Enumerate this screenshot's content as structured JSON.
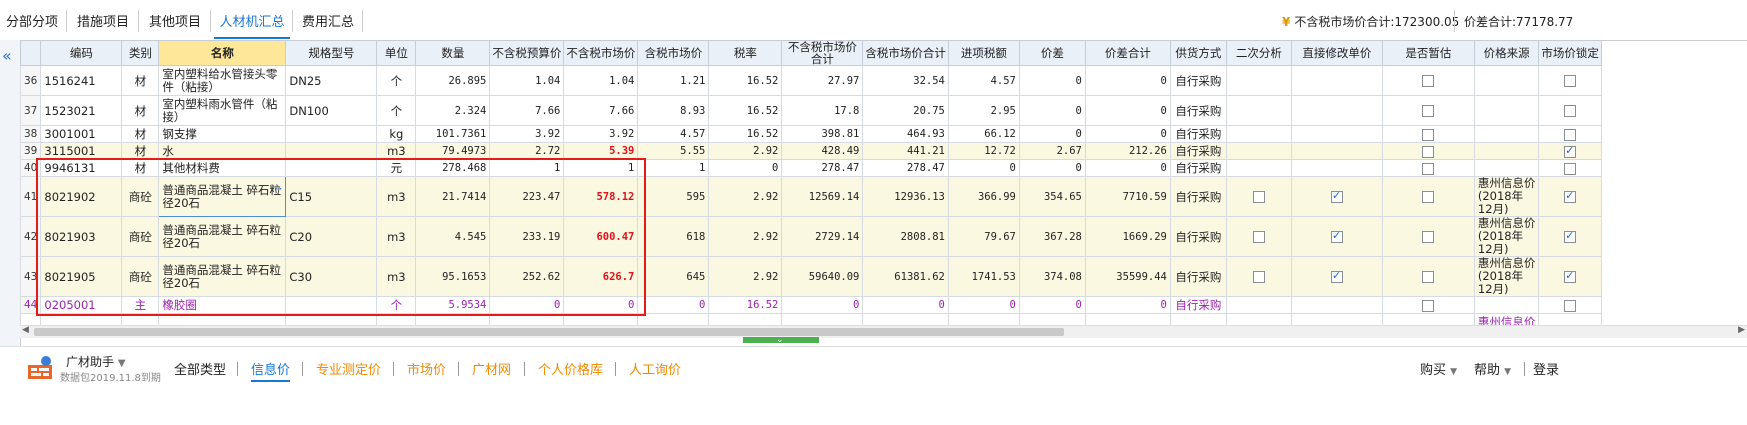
{
  "tabs": [
    {
      "label": "分部分项",
      "active": false
    },
    {
      "label": "措施项目",
      "active": false
    },
    {
      "label": "其他项目",
      "active": false
    },
    {
      "label": "人材机汇总",
      "active": true
    },
    {
      "label": "费用汇总",
      "active": false
    }
  ],
  "summary": {
    "market_total": "不含税市场价合计:172300.05",
    "diff_total": "价差合计:77178.77"
  },
  "columns": [
    "编码",
    "类别",
    "名称",
    "规格型号",
    "单位",
    "数量",
    "不含税预算价",
    "不含税市场价",
    "含税市场价",
    "税率",
    "不含税市场价合计",
    "含税市场价合计",
    "进项税额",
    "价差",
    "价差合计",
    "供货方式",
    "二次分析",
    "直接修改单价",
    "是否暂估",
    "价格来源",
    "市场价锁定"
  ],
  "rows": [
    {
      "idx": "36",
      "code": "1516241",
      "type": "材",
      "name": "室内塑料给水管接头零件（粘接）",
      "spec": "DN25",
      "unit": "个",
      "qty": "26.895",
      "budget": "1.04",
      "market": "1.04",
      "taxmarket": "1.21",
      "rate": "16.52",
      "mtotal": "27.97",
      "tmtotal": "32.54",
      "tax": "4.57",
      "diff": "0",
      "difftotal": "0",
      "supply": "自行采购",
      "second": "",
      "direct": "",
      "provisional": "off",
      "source": "",
      "lock": "off"
    },
    {
      "idx": "37",
      "code": "1523021",
      "type": "材",
      "name": "室内塑料雨水管件（粘接）",
      "spec": "DN100",
      "unit": "个",
      "qty": "2.324",
      "budget": "7.66",
      "market": "7.66",
      "taxmarket": "8.93",
      "rate": "16.52",
      "mtotal": "17.8",
      "tmtotal": "20.75",
      "tax": "2.95",
      "diff": "0",
      "difftotal": "0",
      "supply": "自行采购",
      "second": "",
      "direct": "",
      "provisional": "off",
      "source": "",
      "lock": "off"
    },
    {
      "idx": "38",
      "code": "3001001",
      "type": "材",
      "name": "钢支撑",
      "spec": "",
      "unit": "kg",
      "qty": "101.7361",
      "budget": "3.92",
      "market": "3.92",
      "taxmarket": "4.57",
      "rate": "16.52",
      "mtotal": "398.81",
      "tmtotal": "464.93",
      "tax": "66.12",
      "diff": "0",
      "difftotal": "0",
      "supply": "自行采购",
      "second": "",
      "direct": "",
      "provisional": "off",
      "source": "",
      "lock": "off"
    },
    {
      "idx": "39",
      "code": "3115001",
      "type": "材",
      "name": "水",
      "spec": "",
      "unit": "m3",
      "qty": "79.4973",
      "budget": "2.72",
      "market": "5.39",
      "taxmarket": "5.55",
      "rate": "2.92",
      "mtotal": "428.49",
      "tmtotal": "441.21",
      "tax": "12.72",
      "diff": "2.67",
      "difftotal": "212.26",
      "supply": "自行采购",
      "second": "",
      "direct": "",
      "provisional": "off",
      "source": "",
      "lock": "on"
    },
    {
      "idx": "40",
      "code": "9946131",
      "type": "材",
      "name": "其他材料费",
      "spec": "",
      "unit": "元",
      "qty": "278.468",
      "budget": "1",
      "market": "1",
      "taxmarket": "1",
      "rate": "0",
      "mtotal": "278.47",
      "tmtotal": "278.47",
      "tax": "0",
      "diff": "0",
      "difftotal": "0",
      "supply": "自行采购",
      "second": "",
      "direct": "",
      "provisional": "off",
      "source": "",
      "lock": "off"
    },
    {
      "idx": "41",
      "code": "8021902",
      "type": "商砼",
      "name": "普通商品混凝土 碎石粒径20石",
      "spec": "C15",
      "unit": "m3",
      "qty": "21.7414",
      "budget": "223.47",
      "market": "578.12",
      "taxmarket": "595",
      "rate": "2.92",
      "mtotal": "12569.14",
      "tmtotal": "12936.13",
      "tax": "366.99",
      "diff": "354.65",
      "difftotal": "7710.59",
      "supply": "自行采购",
      "second": "off",
      "direct": "on",
      "provisional": "off",
      "source": "惠州信息价(2018年12月)",
      "lock": "on"
    },
    {
      "idx": "42",
      "code": "8021903",
      "type": "商砼",
      "name": "普通商品混凝土 碎石粒径20石",
      "spec": "C20",
      "unit": "m3",
      "qty": "4.545",
      "budget": "233.19",
      "market": "600.47",
      "taxmarket": "618",
      "rate": "2.92",
      "mtotal": "2729.14",
      "tmtotal": "2808.81",
      "tax": "79.67",
      "diff": "367.28",
      "difftotal": "1669.29",
      "supply": "自行采购",
      "second": "off",
      "direct": "on",
      "provisional": "off",
      "source": "惠州信息价(2018年12月)",
      "lock": "on"
    },
    {
      "idx": "43",
      "code": "8021905",
      "type": "商砼",
      "name": "普通商品混凝土 碎石粒径20石",
      "spec": "C30",
      "unit": "m3",
      "qty": "95.1653",
      "budget": "252.62",
      "market": "626.7",
      "taxmarket": "645",
      "rate": "2.92",
      "mtotal": "59640.09",
      "tmtotal": "61381.62",
      "tax": "1741.53",
      "diff": "374.08",
      "difftotal": "35599.44",
      "supply": "自行采购",
      "second": "off",
      "direct": "on",
      "provisional": "off",
      "source": "惠州信息价(2018年12月)",
      "lock": "on"
    },
    {
      "idx": "44",
      "code": "0205001",
      "type": "主",
      "name": "橡胶圈",
      "spec": "",
      "unit": "个",
      "qty": "5.9534",
      "budget": "0",
      "market": "0",
      "taxmarket": "0",
      "rate": "16.52",
      "mtotal": "0",
      "tmtotal": "0",
      "tax": "0",
      "diff": "0",
      "difftotal": "0",
      "supply": "自行采购",
      "second": "",
      "direct": "",
      "provisional": "off",
      "source": "",
      "lock": "off"
    }
  ],
  "partial_source": "惠州信息价",
  "bottom": {
    "brand": "广材助手",
    "sub": "数据包2019.11.8到期",
    "tabs": [
      "全部类型",
      "信息价",
      "专业测定价",
      "市场价",
      "广材网",
      "个人价格库",
      "人工询价"
    ],
    "right": [
      "购买",
      "帮助",
      "登录"
    ]
  },
  "colors": {
    "accent": "#1777d9",
    "highlight": "#e0121a",
    "orange": "#f08a00",
    "purple": "#9b1fb0",
    "box": "#e31b1b"
  }
}
